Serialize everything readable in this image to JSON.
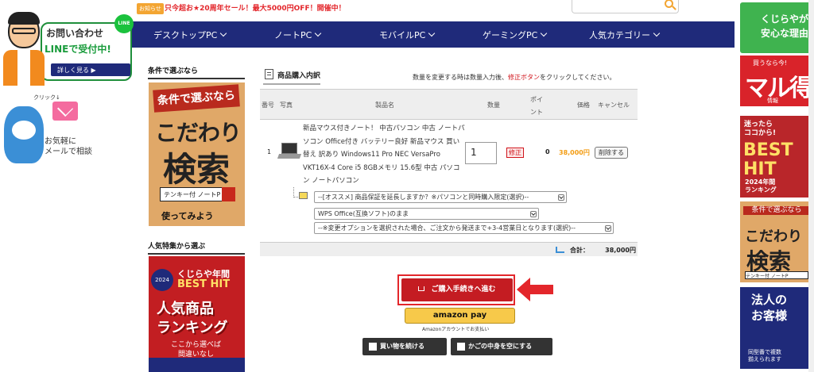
{
  "topbar": {
    "tag": "お知らせ",
    "promo": "只今超お★20周年セール！最大5000円OFF！開催中！"
  },
  "nav": {
    "items": [
      {
        "label": "デスクトップPC"
      },
      {
        "label": "ノートPC"
      },
      {
        "label": "モバイルPC"
      },
      {
        "label": "ゲーミングPC"
      },
      {
        "label": "人気カテゴリー"
      }
    ]
  },
  "left_badge": {
    "q": "お問い合わせ",
    "line": "LINEで受付中!",
    "detail": "詳しく見る ▶",
    "linelogo": "LINE"
  },
  "mail_badge": {
    "click": "クリック↓",
    "text": "お気軽に\nメールで相談"
  },
  "side": {
    "heading1": "条件で選ぶなら",
    "kodawari_top": "条件で選ぶなら",
    "kodawari_mid": "こだわり",
    "kodawari_big": "検索",
    "kodawari_input": "テンキー付 ノートP",
    "kodawari_use": "使ってみよう",
    "heading2": "人気特集から選ぶ",
    "besthit_year": "2024",
    "besthit_1": "くじらや年間",
    "besthit_2": "BEST HIT",
    "besthit_3": "人気商品",
    "besthit_4": "ランキング",
    "besthit_5": "ここから選べば\n間違いなし"
  },
  "cart": {
    "title": "商品購入内訳",
    "note_pre": "数量を変更する時は数量入力後、",
    "note_red": "修正ボタン",
    "note_post": "をクリックしてください。",
    "headers": {
      "num": "番号",
      "photo": "写真",
      "product": "製品名",
      "qty": "数量",
      "points": "ポイント",
      "price": "価格",
      "cancel": "キャンセル"
    },
    "item": {
      "num": "1",
      "name": "新品マウス付きノート！ 中古パソコン 中古 ノートパソコン Office付き バッテリー良好 新品マウス 買い替え 訳あり Windows11 Pro NEC VersaPro VKT16X-4 Core i5 8GBメモリ 15.6型 中古 パソコン ノートパソコン",
      "qty": "1",
      "fix": "修正",
      "points": "0",
      "price": "38,000円",
      "delete": "削除する"
    },
    "options": [
      "--[オススメ] 商品保証を延長しますか？※パソコンと同時購入限定(選択)--",
      "WPS Office(互換ソフト)のまま",
      "--※変更オプションを選択された場合、ご注文から発送まで+3-4営業日となります(選択)--"
    ],
    "subtotal_label": "合計：",
    "subtotal_value": "38,000円"
  },
  "actions": {
    "checkout": "ご購入手続きへ進む",
    "amazon": "amazon pay",
    "amazon_sub": "Amazonアカウントでお支払い",
    "continue": "買い物を続ける",
    "empty": "かごの中身を空にする"
  },
  "right": {
    "r1": "くじらやが\n安心な理由",
    "r2_top": "買うなら今!",
    "r2_big": "マル得",
    "r2_bot": "情報",
    "r3_top": "迷ったら\nココから!",
    "r3_big": "BEST\nHIT",
    "r3_bot": "2024年間\nランキング",
    "r4_top": "条件で選ぶなら",
    "r4_mid": "こだわり",
    "r4_big": "検索",
    "r4_input": "テンキー付 ノートP",
    "r5": "法人の\nお客様",
    "r5_sub": "同型番で複数\n揃えられます"
  }
}
